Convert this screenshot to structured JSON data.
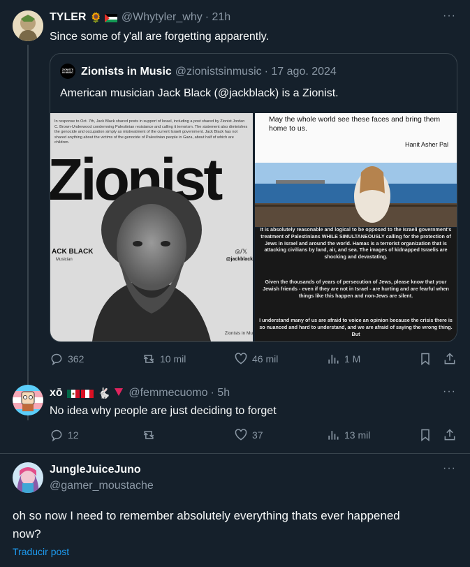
{
  "tweet1": {
    "name": "TYLER",
    "handle": "@Whytyler_why",
    "time": "· 21h",
    "text": "Since some of y'all are forgetting apparently.",
    "quote": {
      "avatar_text": "ZIONISTS IN MUSIC",
      "name": "Zionists in Music",
      "handle": "@zionistsinmusic",
      "time": "· 17 ago. 2024",
      "text": "American musician Jack Black (@jackblack) is a Zionist.",
      "left_image": {
        "caption": "In response to Oct. 7th, Jack Black shared posts in support of Israel, including a post shared by Zionist Jordan C. Brown-Underwood condemning Palestinian resistance and calling it terrorism. The statement also diminishes the genocide and occupation simply as mistreatment of the current Israeli government. Jack Black has not shared anything about the victims of the genocide of Palestinian people in Gaza, about half of which are children.",
        "big_word": "Zionist",
        "person_name": "ACK BLACK",
        "person_role": "Musician",
        "social": "◎/𝕏",
        "social_handle": "@jackblack",
        "footer": "Zionists in Mu"
      },
      "right_top": {
        "line1": "May the whole world see these faces and bring them home to us.",
        "signature": "Hanit Asher Pal"
      },
      "right_bottom": {
        "para1": "It is absolutely reasonable and logical to be opposed to the Israeli government's treatment of Palestinians WHILE SIMULTANEOUSLY calling for the protection of Jews in Israel and around the world. Hamas is a terrorist organization that is attacking civilians by land, air, and sea. The images of kidnapped Israelis are shocking and devastating.",
        "para2": "Given the thousands of years of persecution of Jews, please know that your Jewish friends - even if they are not in Israel - are hurting and are fearful when things like this happen and non-Jews are silent.",
        "para3": "I understand many of us are afraid to voice an opinion because the crisis there is so nuanced and hard to understand, and we are afraid of saying the wrong thing. But"
      }
    },
    "replies": "362",
    "retweets": "10 mil",
    "likes": "46 mil",
    "views": "1 M"
  },
  "tweet2": {
    "name": "xō",
    "handle": "@femmecuomo",
    "time": "· 5h",
    "text": "No idea why people are just deciding to forget",
    "replies": "12",
    "retweets": "",
    "likes": "37",
    "views": "13 mil"
  },
  "tweet3": {
    "name": "JungleJuiceJuno",
    "handle": "@gamer_moustache",
    "text": "oh so now I need to remember absolutely everything thats ever happened now?",
    "translate": "Traducir post"
  },
  "more_glyph": "···",
  "colors": {
    "background": "#15202b",
    "text": "#f7f9f9",
    "muted": "#8b98a5",
    "link": "#1d9bf0",
    "border": "#38444d"
  }
}
